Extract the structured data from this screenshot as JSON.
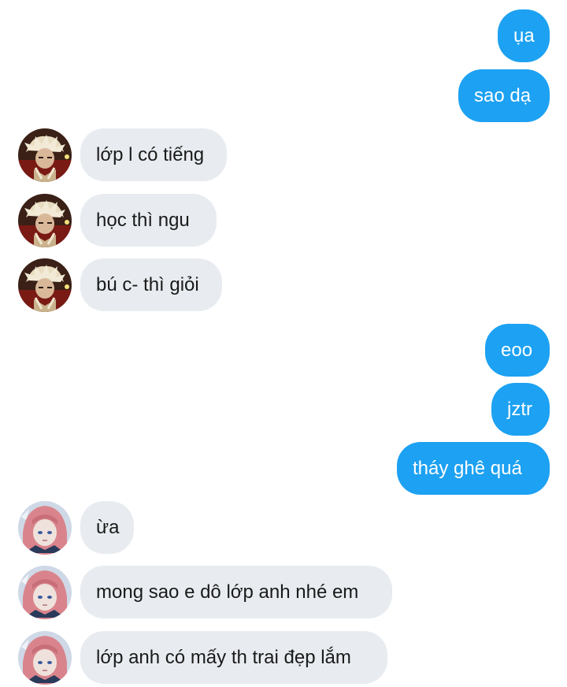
{
  "conversation": {
    "messages": [
      {
        "direction": "outgoing",
        "text": "ụa"
      },
      {
        "direction": "outgoing",
        "text": "sao dạ"
      },
      {
        "direction": "incoming",
        "sender_avatar": "avatar-a",
        "text": "lớp l có tiếng"
      },
      {
        "direction": "incoming",
        "sender_avatar": "avatar-a",
        "text": "học thì ngu"
      },
      {
        "direction": "incoming",
        "sender_avatar": "avatar-a",
        "text": "bú c- thì giỏi"
      },
      {
        "direction": "outgoing",
        "text": "eoo"
      },
      {
        "direction": "outgoing",
        "text": "jztr"
      },
      {
        "direction": "outgoing",
        "text": "tháy ghê quá"
      },
      {
        "direction": "incoming",
        "sender_avatar": "avatar-b",
        "text": "ừa"
      },
      {
        "direction": "incoming",
        "sender_avatar": "avatar-b",
        "text": "mong sao e dô lớp anh nhé em"
      },
      {
        "direction": "incoming",
        "sender_avatar": "avatar-b",
        "text": "lớp anh có mấy th trai đẹp lắm"
      }
    ]
  },
  "colors": {
    "outgoing_bubble": "#1da1f2",
    "incoming_bubble": "#e8ecf0",
    "background": "#ffffff"
  }
}
